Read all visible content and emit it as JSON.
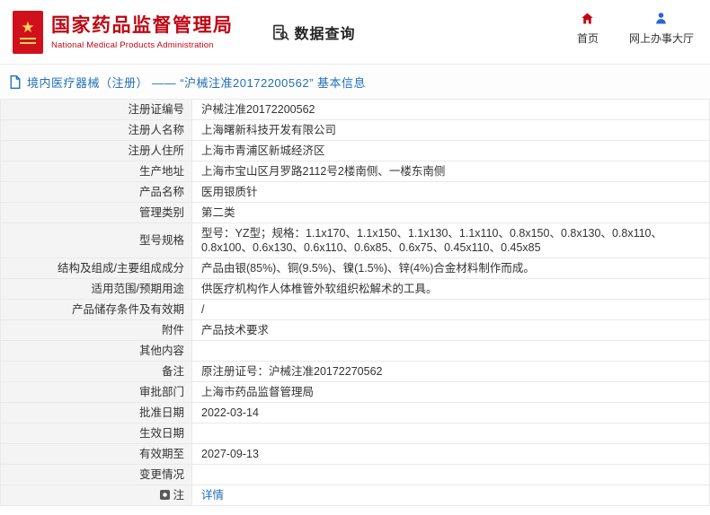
{
  "header": {
    "org_name_cn": "国家药品监督管理局",
    "org_name_en": "National Medical Products Administration",
    "nav_data_query": "数据查询",
    "nav_home": "首页",
    "nav_hall": "网上办事大厅"
  },
  "title_bar": {
    "text": "境内医疗器械（注册） —— “沪械注准20172200562” 基本信息"
  },
  "colors": {
    "brand_red": "#c00714",
    "link_blue": "#2170b8",
    "label_bg": "#f4f4f4"
  },
  "table": {
    "rows": [
      {
        "label": "注册证编号",
        "value": "沪械注准20172200562"
      },
      {
        "label": "注册人名称",
        "value": "上海曙新科技开发有限公司"
      },
      {
        "label": "注册人住所",
        "value": "上海市青浦区新城经济区"
      },
      {
        "label": "生产地址",
        "value": "上海市宝山区月罗路2112号2楼南侧、一楼东南侧"
      },
      {
        "label": "产品名称",
        "value": "医用银质针"
      },
      {
        "label": "管理类别",
        "value": "第二类"
      },
      {
        "label": "型号规格",
        "value": "型号：YZ型；规格：1.1x170、1.1x150、1.1x130、1.1x110、0.8x150、0.8x130、0.8x110、0.8x100、0.6x130、0.6x110、0.6x85、0.6x75、0.45x110、0.45x85"
      },
      {
        "label": "结构及组成/主要组成成分",
        "value": "产品由银(85%)、铜(9.5%)、镍(1.5%)、锌(4%)合金材料制作而成。"
      },
      {
        "label": "适用范围/预期用途",
        "value": "供医疗机构作人体椎管外软组织松解术的工具。"
      },
      {
        "label": "产品储存条件及有效期",
        "value": "/"
      },
      {
        "label": "附件",
        "value": "产品技术要求"
      },
      {
        "label": "其他内容",
        "value": ""
      },
      {
        "label": "备注",
        "value": "原注册证号：沪械注准20172270562"
      },
      {
        "label": "审批部门",
        "value": "上海市药品监督管理局"
      },
      {
        "label": "批准日期",
        "value": "2022-03-14"
      },
      {
        "label": "生效日期",
        "value": ""
      },
      {
        "label": "有效期至",
        "value": "2027-09-13"
      },
      {
        "label": "变更情况",
        "value": ""
      },
      {
        "label": "注",
        "value": "详情",
        "link": true,
        "icon": true
      }
    ]
  }
}
